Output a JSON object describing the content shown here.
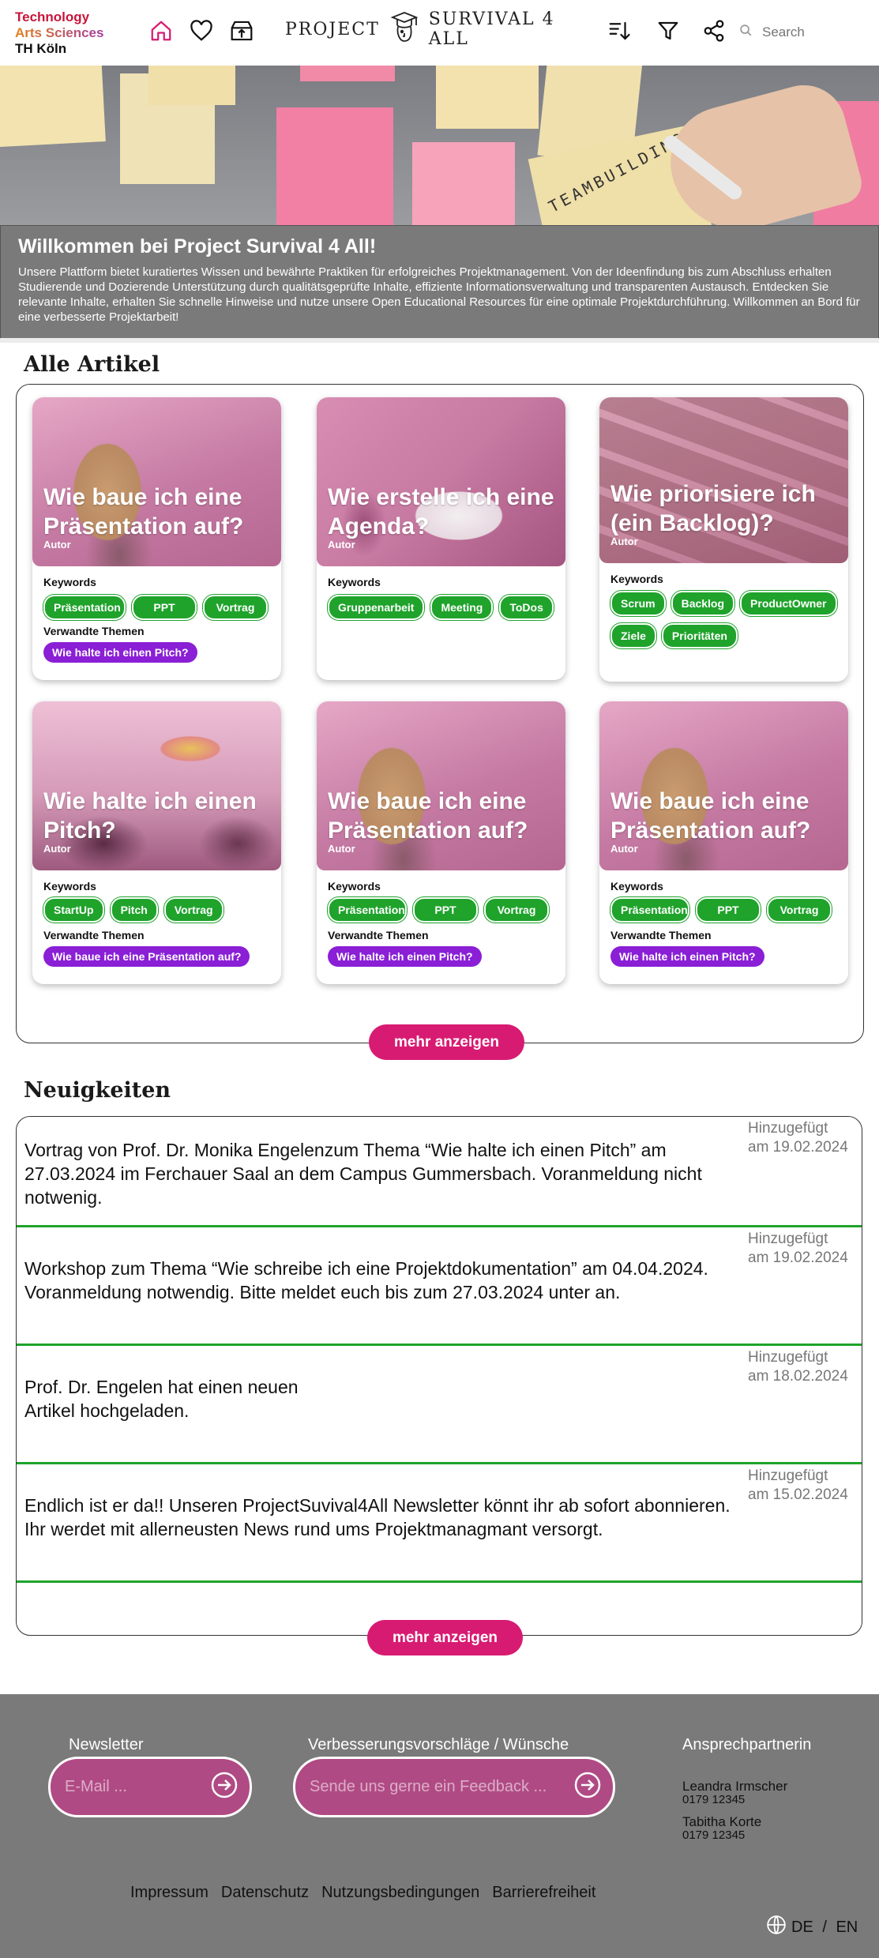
{
  "header": {
    "logo": {
      "line1": "Technology",
      "line2": "Arts Sciences",
      "line3": "TH Köln"
    },
    "brand_left": "PROJECT",
    "brand_right": "SURVIVAL 4 ALL",
    "search_placeholder": "Search"
  },
  "hero": {
    "note_text": "TEAMBUILDING"
  },
  "welcome": {
    "title": "Willkommen bei Project Survival 4 All!",
    "text": "Unsere Plattform bietet kuratiertes Wissen und bewährte Praktiken für erfolgreiches Projektmanagement. Von der Ideenfindung bis zum Abschluss erhalten Studierende und Dozierende Unterstützung durch qualitätsgeprüfte Inhalte, effiziente Informationsverwaltung und transparenten Austausch. Entdecken Sie relevante Inhalte, erhalten Sie schnelle Hinweise und nutze unsere Open Educational Resources für eine optimale Projektdurchführung. Willkommen an Bord für eine verbesserte Projektarbeit!"
  },
  "articles": {
    "section_title": "Alle Artikel",
    "keywords_label": "Keywords",
    "related_label": "Verwandte Themen",
    "more_label": "mehr anzeigen",
    "cards": [
      {
        "title": "Wie baue ich eine Präsentation auf?",
        "author": "Autor",
        "keywords": [
          "Präsentation",
          "PPT",
          "Vortrag"
        ],
        "related": "Wie halte ich einen Pitch?"
      },
      {
        "title": "Wie erstelle ich eine Agenda?",
        "author": "Autor",
        "keywords": [
          "Gruppenarbeit",
          "Meeting",
          "ToDos"
        ],
        "related": ""
      },
      {
        "title": "Wie priorisiere ich (ein Backlog)?",
        "author": "Autor",
        "keywords": [
          "Scrum",
          "Backlog",
          "ProductOwner",
          "Ziele",
          "Prioritäten"
        ],
        "related": ""
      },
      {
        "title": "Wie halte ich einen Pitch?",
        "author": "Autor",
        "keywords": [
          "StartUp",
          "Pitch",
          "Vortrag"
        ],
        "related": "Wie baue ich eine Präsentation auf?"
      },
      {
        "title": "Wie baue ich eine Präsentation auf?",
        "author": "Autor",
        "keywords": [
          "Präsentation",
          "PPT",
          "Vortrag"
        ],
        "related": "Wie halte ich einen Pitch?"
      },
      {
        "title": "Wie baue ich eine Präsentation auf?",
        "author": "Autor",
        "keywords": [
          "Präsentation",
          "PPT",
          "Vortrag"
        ],
        "related": "Wie halte ich einen Pitch?"
      }
    ]
  },
  "news": {
    "section_title": "Neuigkeiten",
    "more_label": "mehr anzeigen",
    "items": [
      {
        "text": "Vortrag von Prof. Dr. Monika Engelenzum Thema “Wie halte ich einen Pitch” am 27.03.2024 im Ferchauer Saal an dem Campus Gummersbach. Voranmeldung nicht notwenig.",
        "date_label": "Hinzugefügt",
        "date": "am 19.02.2024"
      },
      {
        "text": "Workshop zum Thema “Wie schreibe ich eine Projektdokumentation” am 04.04.2024. Voranmeldung notwendig. Bitte meldet euch bis zum 27.03.2024 unter  an.",
        "date_label": "Hinzugefügt",
        "date": "am 19.02.2024"
      },
      {
        "text": "Prof. Dr. Engelen hat einen neuen\nArtikel hochgeladen.",
        "date_label": "Hinzugefügt",
        "date": "am 18.02.2024"
      },
      {
        "text": "Endlich ist er da!! Unseren ProjectSuvival4All Newsletter könnt ihr ab sofort abonnieren. Ihr werdet mit allerneusten News rund ums Projektmanagmant versorgt.",
        "date_label": "Hinzugefügt",
        "date": "am 15.02.2024"
      }
    ]
  },
  "footer": {
    "newsletter_label": "Newsletter",
    "newsletter_placeholder": "E-Mail ...",
    "feedback_label": "Verbesserungsvorschläge / Wünsche",
    "feedback_placeholder": "Sende uns gerne ein Feedback ...",
    "contact_label": "Ansprechpartnerin",
    "contacts": [
      {
        "name": "Leandra Irmscher",
        "phone": "0179 12345"
      },
      {
        "name": "Tabitha Korte",
        "phone": "0179 12345"
      }
    ],
    "links": [
      "Impressum",
      "Datenschutz",
      "Nutzungsbedingungen",
      "Barrierefreiheit"
    ],
    "lang_active": "DE",
    "lang_sep": " / ",
    "lang_other": "EN"
  },
  "colors": {
    "accent_pink": "#d81b72",
    "tag_green": "#1fa32b",
    "related_purple": "#8a1fd6",
    "footer_gray": "#7a7a7a"
  }
}
